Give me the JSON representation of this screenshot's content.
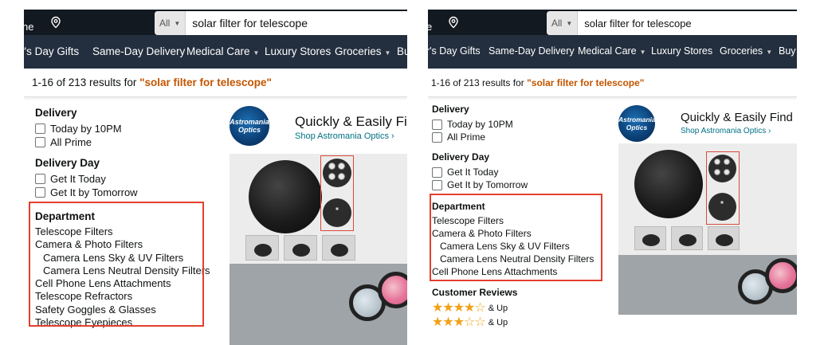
{
  "search": {
    "category": "All",
    "query": "solar filter for telescope"
  },
  "left_panel": {
    "logo_fragment": "ne",
    "nav": [
      "r's Day Gifts",
      "Same-Day Delivery",
      "Medical Care",
      "Luxury Stores",
      "Groceries",
      "Bu"
    ],
    "results_prefix": "1-16 of 213 results for ",
    "results_query": "\"solar filter for telescope\"",
    "delivery": {
      "title": "Delivery",
      "options": [
        "Today by 10PM",
        "All Prime"
      ]
    },
    "delivery_day": {
      "title": "Delivery Day",
      "options": [
        "Get It Today",
        "Get It by Tomorrow"
      ]
    },
    "department": {
      "title": "Department",
      "items": [
        "Telescope Filters",
        "Camera & Photo Filters",
        "Camera Lens Sky & UV Filters",
        "Camera Lens Neutral Density Filters",
        "Cell Phone Lens Attachments",
        "Telescope Refractors",
        "Safety Goggles & Glasses",
        "Telescope Eyepieces"
      ]
    },
    "sponsor": {
      "logo_text_1": "Astromania",
      "logo_text_2": "Optics",
      "title": "Quickly & Easily Find",
      "link": "Shop Astromania Optics ›"
    }
  },
  "right_panel": {
    "logo_fragment": "e",
    "nav": [
      "r's Day Gifts",
      "Same-Day Delivery",
      "Medical Care",
      "Luxury Stores",
      "Groceries",
      "Buy"
    ],
    "results_prefix": "1-16 of 213 results for ",
    "results_query": "\"solar filter for telescope\"",
    "delivery": {
      "title": "Delivery",
      "options": [
        "Today by 10PM",
        "All Prime"
      ]
    },
    "delivery_day": {
      "title": "Delivery Day",
      "options": [
        "Get It Today",
        "Get It by Tomorrow"
      ]
    },
    "department": {
      "title": "Department",
      "items": [
        "Telescope Filters",
        "Camera & Photo Filters",
        "Camera Lens Sky & UV Filters",
        "Camera Lens Neutral Density Filters",
        "Cell Phone Lens Attachments"
      ]
    },
    "reviews": {
      "title": "Customer Reviews",
      "rows": [
        {
          "rating": 4,
          "label": "& Up"
        },
        {
          "rating": 3,
          "label": "& Up"
        }
      ]
    },
    "sponsor": {
      "logo_text_1": "Astromania",
      "logo_text_2": "Optics",
      "title": "Quickly & Easily Find B",
      "link": "Shop Astromania Optics ›"
    }
  },
  "colors": {
    "topbar": "#131921",
    "navbar": "#232f3e",
    "query_orange": "#c45500",
    "highlight_red": "#e4402c",
    "link_teal": "#007185",
    "star": "#f0a116"
  },
  "icons": {
    "location": "location-pin-icon",
    "caret": "caret-down-icon",
    "star": "star-icon"
  }
}
